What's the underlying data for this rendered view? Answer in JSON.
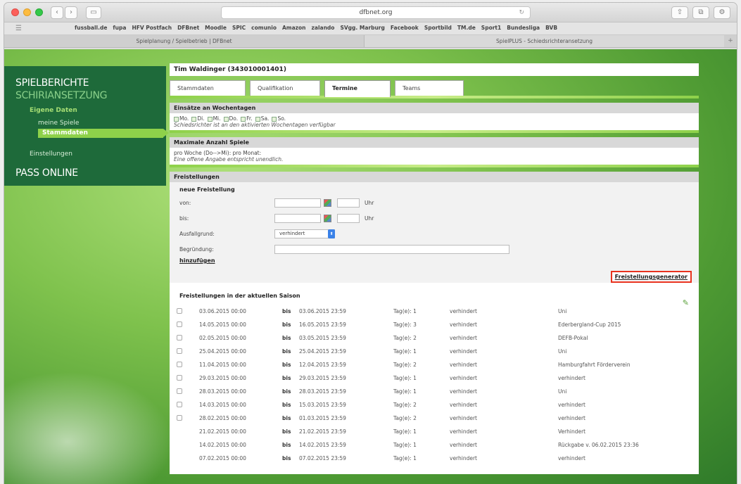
{
  "browser": {
    "url": "dfbnet.org",
    "reload_icon": "↻",
    "share_icon": "⇧",
    "tabs_icon": "⧉",
    "back_icon": "‹",
    "forward_icon": "›",
    "sidebar_icon": "▭",
    "bookmarks_icon": "☰",
    "bookmarks": [
      "fussball.de",
      "fupa",
      "HFV Postfach",
      "DFBnet",
      "Moodle",
      "SPIC",
      "comunio",
      "Amazon",
      "zalando",
      "SVgg. Marburg",
      "Facebook",
      "Sportbild",
      "TM.de",
      "Sport1",
      "Bundesliga",
      "BVB"
    ],
    "tabs": [
      "Spielplanung / Spielbetrieb | DFBnet",
      "SpielPLUS - Schiedsrichteransetzung"
    ]
  },
  "sidebar": {
    "spielberichte": "SPIELBERICHTE",
    "schiriansetzung": "SCHIRIANSETZUNG",
    "eigene_daten": "Eigene Daten",
    "meine_spiele": "meine Spiele",
    "stammdaten": "Stammdaten",
    "einstellungen": "Einstellungen",
    "pass_online": "PASS ONLINE"
  },
  "main": {
    "name": "Tim Waldinger (343010001401)",
    "tabs": [
      "Stammdaten",
      "Qualifikation",
      "Termine",
      "Teams"
    ],
    "active_tab": "Termine"
  },
  "einsaetze": {
    "title": "Einsätze an Wochentagen",
    "days": [
      "Mo.",
      "Di.",
      "Mi.",
      "Do.",
      "Fr.",
      "Sa.",
      "So."
    ],
    "note": "Schiedsrichter ist an den aktivierten Wochentagen verfügbar"
  },
  "max_spiele": {
    "title": "Maximale Anzahl Spiele",
    "text": "pro Woche (Do-->Mi):    pro Monat:",
    "note": "Eine offene Angabe entspricht unendlich."
  },
  "freistellungen": {
    "title": "Freistellungen",
    "new_title": "neue Freistellung",
    "von_label": "von:",
    "bis_label": "bis:",
    "uhr_label": "Uhr",
    "ausfallgrund_label": "Ausfallgrund:",
    "ausfallgrund_value": "verhindert",
    "select_arrow": "⬍",
    "begruendung_label": "Begründung:",
    "add_label": "hinzufügen",
    "generator_label": "Freistellungsgenerator",
    "list_title": "Freistellungen in der aktuellen Saison",
    "edit_icon": "✎",
    "bis_word": "bis",
    "rows": [
      {
        "from": "03.06.2015 00:00",
        "to": "03.06.2015 23:59",
        "days": "Tag(e): 1",
        "reason": "verhindert",
        "comment": "Uni",
        "checkbox": true
      },
      {
        "from": "14.05.2015 00:00",
        "to": "16.05.2015 23:59",
        "days": "Tag(e): 3",
        "reason": "verhindert",
        "comment": "Ederbergland-Cup 2015",
        "checkbox": true
      },
      {
        "from": "02.05.2015 00:00",
        "to": "03.05.2015 23:59",
        "days": "Tag(e): 2",
        "reason": "verhindert",
        "comment": "DEFB-Pokal",
        "checkbox": true
      },
      {
        "from": "25.04.2015 00:00",
        "to": "25.04.2015 23:59",
        "days": "Tag(e): 1",
        "reason": "verhindert",
        "comment": "Uni",
        "checkbox": true
      },
      {
        "from": "11.04.2015 00:00",
        "to": "12.04.2015 23:59",
        "days": "Tag(e): 2",
        "reason": "verhindert",
        "comment": "Hamburgfahrt Förderverein",
        "checkbox": true
      },
      {
        "from": "29.03.2015 00:00",
        "to": "29.03.2015 23:59",
        "days": "Tag(e): 1",
        "reason": "verhindert",
        "comment": "verhindert",
        "checkbox": true
      },
      {
        "from": "28.03.2015 00:00",
        "to": "28.03.2015 23:59",
        "days": "Tag(e): 1",
        "reason": "verhindert",
        "comment": "Uni",
        "checkbox": true
      },
      {
        "from": "14.03.2015 00:00",
        "to": "15.03.2015 23:59",
        "days": "Tag(e): 2",
        "reason": "verhindert",
        "comment": "verhindert",
        "checkbox": true
      },
      {
        "from": "28.02.2015 00:00",
        "to": "01.03.2015 23:59",
        "days": "Tag(e): 2",
        "reason": "verhindert",
        "comment": "verhindert",
        "checkbox": true
      },
      {
        "from": "21.02.2015 00:00",
        "to": "21.02.2015 23:59",
        "days": "Tag(e): 1",
        "reason": "verhindert",
        "comment": "Verhindert",
        "checkbox": false
      },
      {
        "from": "14.02.2015 00:00",
        "to": "14.02.2015 23:59",
        "days": "Tag(e): 1",
        "reason": "verhindert",
        "comment": "Rückgabe v. 06.02.2015 23:36",
        "checkbox": false
      },
      {
        "from": "07.02.2015 00:00",
        "to": "07.02.2015 23:59",
        "days": "Tag(e): 1",
        "reason": "verhindert",
        "comment": "verhindert",
        "checkbox": false
      }
    ]
  },
  "colors": {
    "sidebar_bg": "#1e6a3a",
    "accent": "#8ed14a",
    "highlight": "#e8321e"
  }
}
